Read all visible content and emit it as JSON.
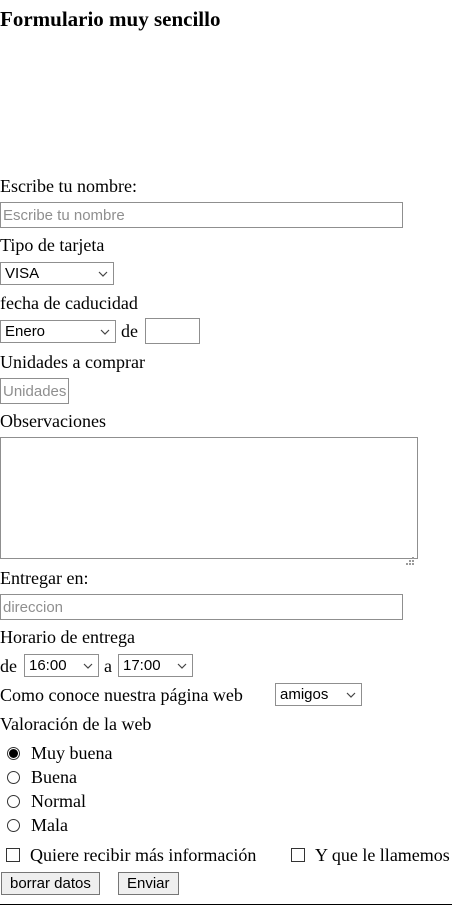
{
  "form": {
    "title": "Formulario muy sencillo",
    "name_label": "Escribe tu nombre:",
    "name_placeholder": "Escribe tu nombre",
    "card_type_label": "Tipo de tarjeta",
    "card_type_selected": "VISA",
    "expiry_label": "fecha de caducidad",
    "expiry_month_selected": "Enero",
    "expiry_de": "de",
    "expiry_year_value": "",
    "units_label": "Unidades a comprar",
    "units_placeholder": "Unidades",
    "observations_label": "Observaciones",
    "observations_value": "",
    "deliver_label": "Entregar en:",
    "deliver_placeholder": "direccion",
    "schedule_label": "Horario de entrega",
    "schedule_de": "de",
    "schedule_from_selected": "16:00",
    "schedule_a": "a",
    "schedule_to_selected": "17:00",
    "source_label": "Como conoce nuestra página web",
    "source_selected": "amigos",
    "rating_label": "Valoración de la web",
    "rating_options": [
      {
        "label": "Muy buena",
        "checked": true
      },
      {
        "label": "Buena",
        "checked": false
      },
      {
        "label": "Normal",
        "checked": false
      },
      {
        "label": "Mala",
        "checked": false
      }
    ],
    "more_info_label": "Quiere recibir más información",
    "call_label": "Y que le llamemos",
    "reset_button": "borrar datos",
    "submit_button": "Enviar"
  },
  "icons": {
    "select_arrow": "chevron-down-icon",
    "textarea_resize": "resize-grip-icon"
  },
  "colors": {
    "border": "#8f8f8f",
    "placeholder": "#8f8f8f",
    "button_bg": "#efefef",
    "text": "#000000"
  }
}
